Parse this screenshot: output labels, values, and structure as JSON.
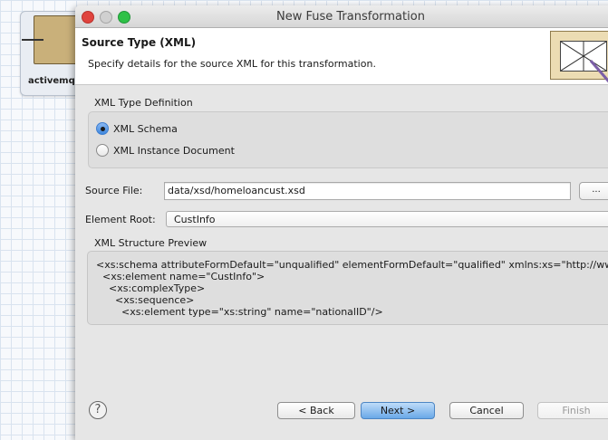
{
  "background": {
    "node_label": "activemq:"
  },
  "dialog": {
    "title": "New Fuse Transformation",
    "header_title": "Source Type (XML)",
    "header_description": "Specify details for the source XML for this transformation."
  },
  "xml_type": {
    "group_label": "XML Type Definition",
    "options": [
      {
        "label": "XML Schema",
        "selected": true
      },
      {
        "label": "XML Instance Document",
        "selected": false
      }
    ]
  },
  "source_file": {
    "label": "Source File:",
    "value": "data/xsd/homeloancust.xsd",
    "browse_label": "..."
  },
  "element_root": {
    "label": "Element Root:",
    "value": "CustInfo",
    "arrow": "↕"
  },
  "preview": {
    "label": "XML Structure Preview",
    "lines": [
      "<xs:schema attributeFormDefault=\"unqualified\" elementFormDefault=\"qualified\" xmlns:xs=\"http://www.w",
      "  <xs:element name=\"CustInfo\">",
      "    <xs:complexType>",
      "      <xs:sequence>",
      "        <xs:element type=\"xs:string\" name=\"nationalID\"/>"
    ]
  },
  "buttons": {
    "help": "?",
    "back": "< Back",
    "next": "Next >",
    "cancel": "Cancel",
    "finish": "Finish"
  },
  "colors": {
    "accent": "#3d87dd",
    "arrow": "#7b5ea7"
  }
}
